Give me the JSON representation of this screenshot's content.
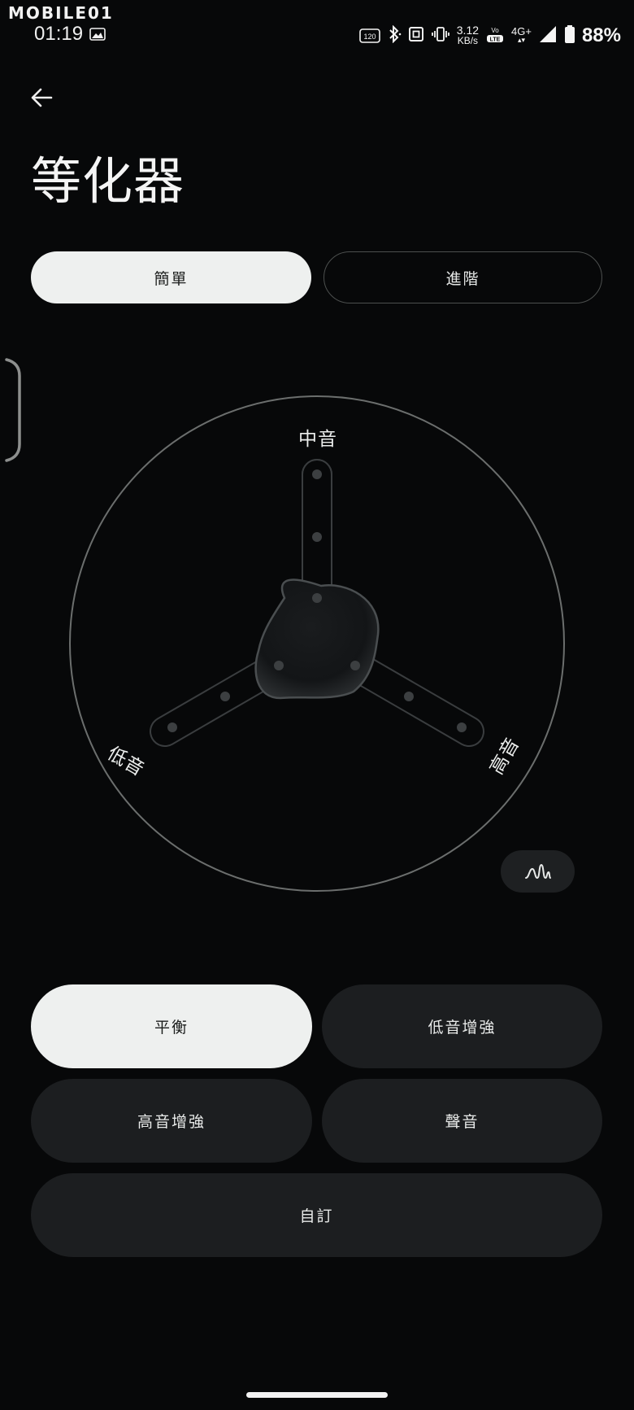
{
  "watermark": {
    "text": "MOBILE01"
  },
  "status_bar": {
    "time": "01:19",
    "refresh_badge": "120",
    "net_speed_value": "3.12",
    "net_speed_unit": "KB/s",
    "volte_label": "VoLTE",
    "network_type": "4G+",
    "battery_percent": "88%"
  },
  "header": {
    "title": "等化器"
  },
  "mode_tabs": {
    "simple": "簡單",
    "advanced": "進階",
    "selected": "簡單"
  },
  "equalizer": {
    "bands": {
      "mid": "中音",
      "bass": "低音",
      "treble": "高音"
    },
    "levels": {
      "bass": 0,
      "mid": 0,
      "treble": 0
    },
    "wave_button_icon": "waveform-icon"
  },
  "presets": {
    "items": [
      "平衡",
      "低音增強",
      "高音增強",
      "聲音",
      "自訂"
    ],
    "selected": "平衡"
  },
  "colors": {
    "background": "#070809",
    "active_fill": "#eef0ef",
    "inactive_fill": "#1c1e20",
    "ring": "#6b6e6d"
  }
}
